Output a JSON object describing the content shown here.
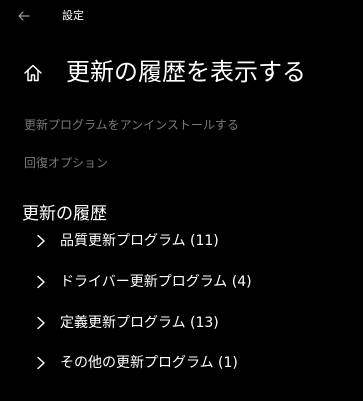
{
  "window": {
    "title": "設定"
  },
  "page": {
    "title": "更新の履歴を表示する"
  },
  "links": {
    "uninstall": "更新プログラムをアンインストールする",
    "recovery": "回復オプション"
  },
  "history": {
    "heading": "更新の履歴",
    "groups": [
      {
        "label": "品質更新プログラム (11)"
      },
      {
        "label": "ドライバー更新プログラム (4)"
      },
      {
        "label": "定義更新プログラム (13)"
      },
      {
        "label": "その他の更新プログラム (1)"
      }
    ]
  },
  "icons": {
    "back": "back-arrow-icon",
    "home": "home-icon",
    "expand": "chevron-right-icon"
  },
  "colors": {
    "background": "#000000",
    "text": "#ffffff",
    "link_text": "#7a7a7a"
  }
}
